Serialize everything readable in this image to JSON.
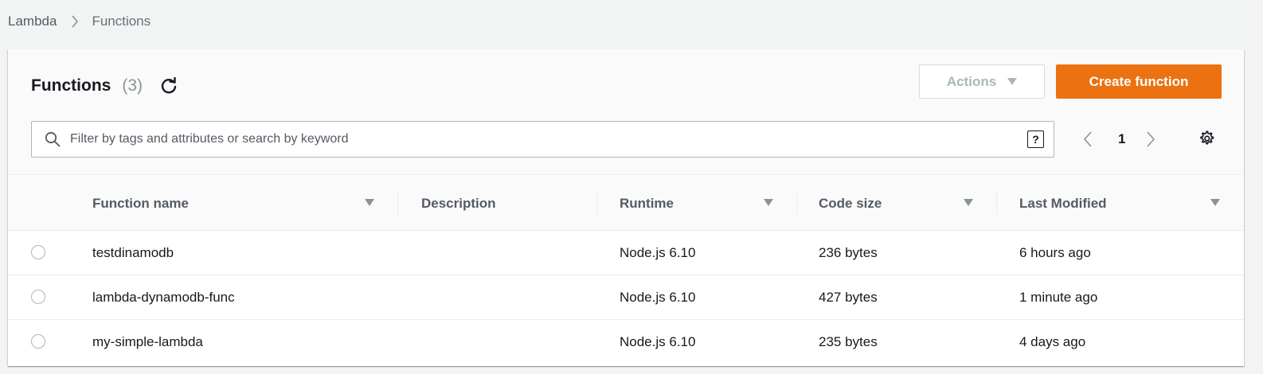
{
  "breadcrumb": {
    "root": "Lambda",
    "current": "Functions"
  },
  "header": {
    "title": "Functions",
    "count": "(3)",
    "actions_label": "Actions",
    "create_label": "Create function"
  },
  "search": {
    "placeholder": "Filter by tags and attributes or search by keyword",
    "help_label": "?"
  },
  "pagination": {
    "current_page": "1"
  },
  "table": {
    "columns": {
      "name": "Function name",
      "description": "Description",
      "runtime": "Runtime",
      "code_size": "Code size",
      "last_modified": "Last Modified"
    },
    "rows": [
      {
        "name": "testdinamodb",
        "description": "",
        "runtime": "Node.js 6.10",
        "code_size": "236 bytes",
        "last_modified": "6 hours ago"
      },
      {
        "name": "lambda-dynamodb-func",
        "description": "",
        "runtime": "Node.js 6.10",
        "code_size": "427 bytes",
        "last_modified": "1 minute ago"
      },
      {
        "name": "my-simple-lambda",
        "description": "",
        "runtime": "Node.js 6.10",
        "code_size": "235 bytes",
        "last_modified": "4 days ago"
      }
    ]
  },
  "icons": {
    "refresh": "refresh-icon",
    "search": "search-icon",
    "settings": "gear-icon",
    "sort": "caret-down-icon"
  },
  "colors": {
    "primary_button": "#ec7211",
    "background": "#f2f3f3",
    "header_bg": "#fafafa"
  }
}
